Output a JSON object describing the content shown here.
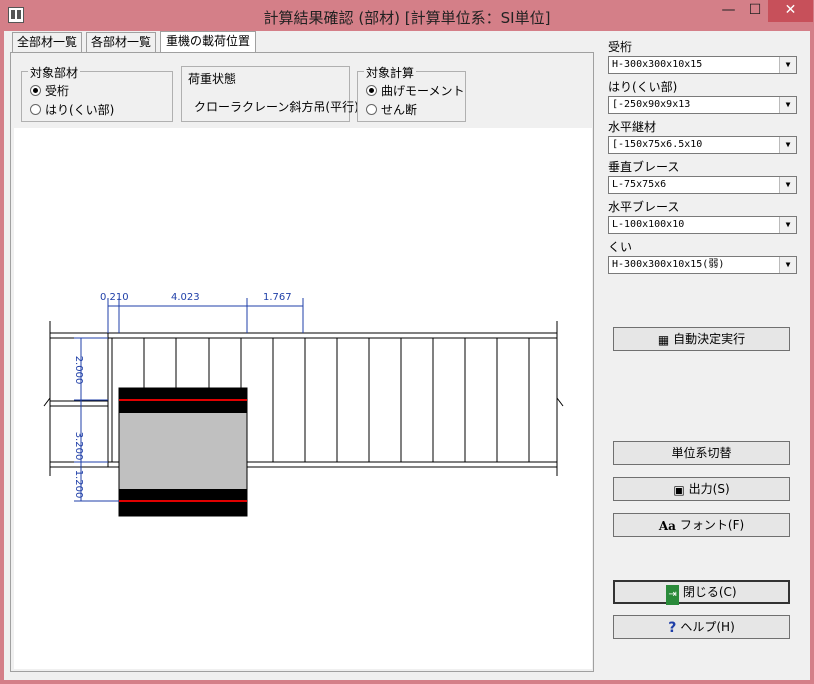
{
  "window": {
    "title": "計算結果確認 (部材) [計算単位系：SI単位]",
    "min_glyph": "—",
    "max_glyph": "☐",
    "close_glyph": "✕"
  },
  "tabs": [
    {
      "label": "全部材一覧"
    },
    {
      "label": "各部材一覧"
    },
    {
      "label": "重機の載荷位置"
    }
  ],
  "target_member": {
    "title": "対象部材",
    "options": [
      {
        "label": "受桁",
        "selected": true
      },
      {
        "label": "はり(くい部)",
        "selected": false
      }
    ]
  },
  "load_state": {
    "title": "荷重状態",
    "value": "クローラクレーン斜方吊(平行)"
  },
  "target_calc": {
    "title": "対象計算",
    "options": [
      {
        "label": "曲げモーメント",
        "selected": true
      },
      {
        "label": "せん断",
        "selected": false
      }
    ]
  },
  "drawing": {
    "dims_top": [
      "0.210",
      "4.023",
      "1.767"
    ],
    "dims_left": [
      "2.000",
      "3.200",
      "1.200"
    ],
    "colors": {
      "line": "#000000",
      "dim": "#1f3fa8",
      "track": "#000000",
      "stripe": "#e00000",
      "body": "#c0c0c0"
    }
  },
  "members": [
    {
      "label": "受桁",
      "value": "H-300x300x10x15"
    },
    {
      "label": "はり(くい部)",
      "value": "[-250x90x9x13"
    },
    {
      "label": "水平継材",
      "value": "[-150x75x6.5x10"
    },
    {
      "label": "垂直ブレース",
      "value": "L-75x75x6"
    },
    {
      "label": "水平ブレース",
      "value": "L-100x100x10"
    },
    {
      "label": "くい",
      "value": "H-300x300x10x15(弱)"
    }
  ],
  "buttons": {
    "auto": "自動決定実行",
    "units": "単位系切替",
    "output": "出力(S)",
    "font": "フォント(F)",
    "close": "閉じる(C)",
    "help": "ヘルプ(H)"
  }
}
